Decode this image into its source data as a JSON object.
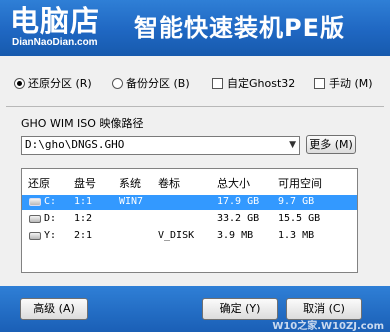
{
  "header": {
    "brand": "电脑店",
    "brand_sub": "DianNaoDian.com",
    "title": "智能快速装机PE版"
  },
  "options": {
    "restore": "还原分区 (R)",
    "backup": "备份分区 (B)",
    "custom_ghost": "自定Ghost32",
    "manual": "手动 (M)",
    "selected": "restore"
  },
  "path": {
    "label": "GHO WIM ISO 映像路径",
    "value": "D:\\gho\\DNGS.GHO",
    "more_button": "更多 (M)"
  },
  "table": {
    "headers": [
      "还原",
      "盘号",
      "系统",
      "卷标",
      "总大小",
      "可用空间"
    ],
    "rows": [
      {
        "drive": "C:",
        "num": "1:1",
        "system": "WIN7",
        "label": "",
        "total": "17.9 GB",
        "free": "9.7 GB",
        "selected": true
      },
      {
        "drive": "D:",
        "num": "1:2",
        "system": "",
        "label": "",
        "total": "33.2 GB",
        "free": "15.5 GB",
        "selected": false
      },
      {
        "drive": "Y:",
        "num": "2:1",
        "system": "",
        "label": "V_DISK",
        "total": "3.9 MB",
        "free": "1.3 MB",
        "selected": false
      }
    ]
  },
  "footer": {
    "advanced": "高级 (A)",
    "ok": "确定 (Y)",
    "cancel": "取消 (C)",
    "watermark": "W10之家.W10ZJ.com"
  },
  "colors": {
    "header_blue": "#1f67c2",
    "selection": "#3399ff"
  }
}
